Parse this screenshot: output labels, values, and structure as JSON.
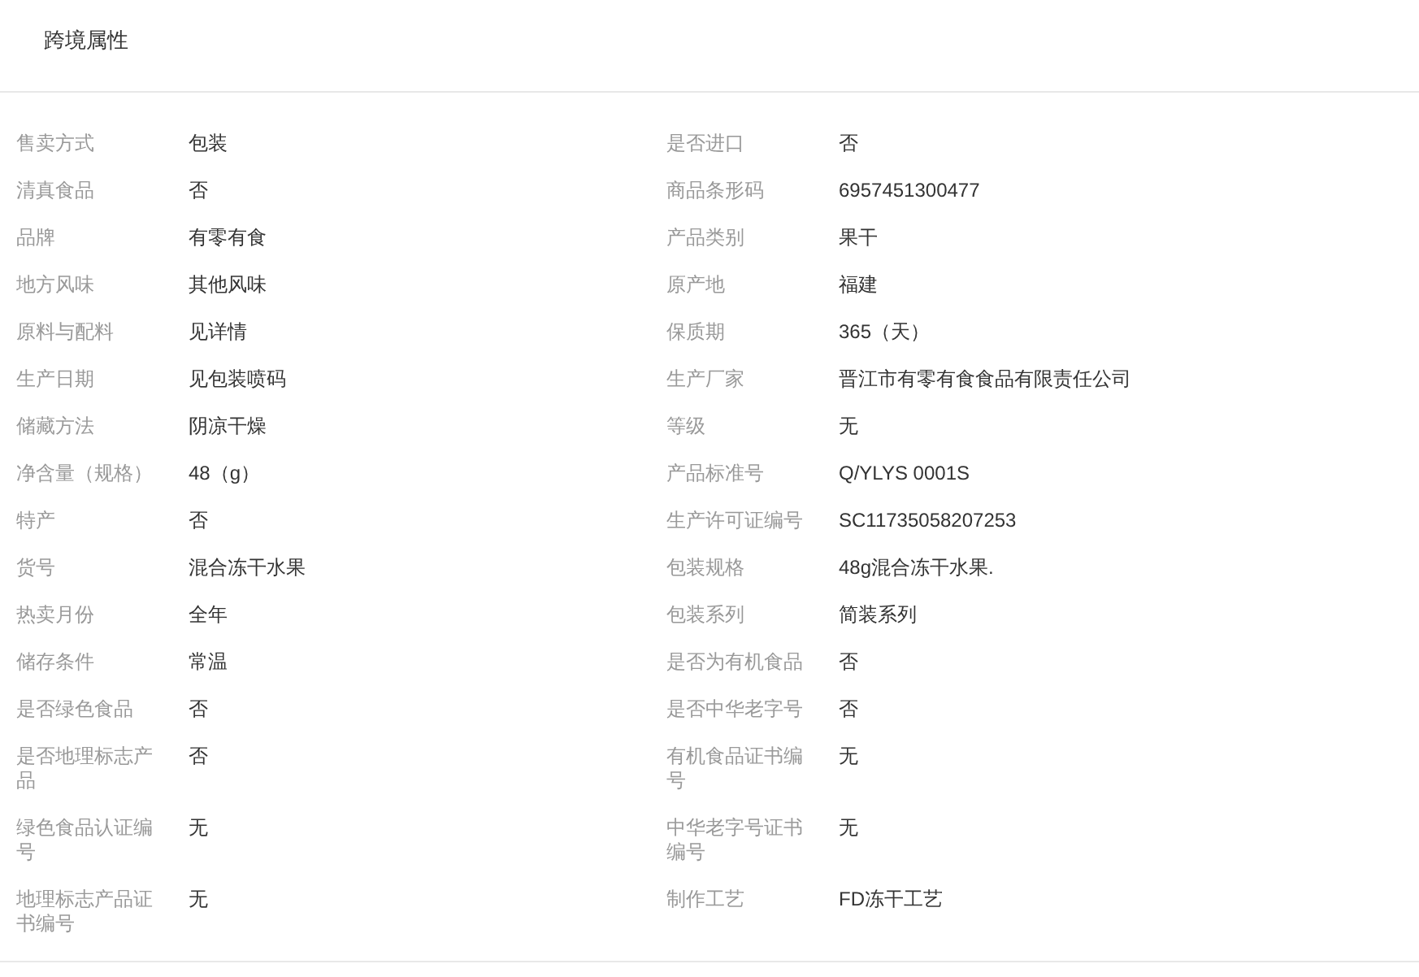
{
  "section": {
    "title": "跨境属性"
  },
  "attributes": [
    {
      "label": "售卖方式",
      "value": "包装"
    },
    {
      "label": "是否进口",
      "value": "否"
    },
    {
      "label": "清真食品",
      "value": "否"
    },
    {
      "label": "商品条形码",
      "value": "6957451300477"
    },
    {
      "label": "品牌",
      "value": "有零有食"
    },
    {
      "label": "产品类别",
      "value": "果干"
    },
    {
      "label": "地方风味",
      "value": "其他风味"
    },
    {
      "label": "原产地",
      "value": "福建"
    },
    {
      "label": "原料与配料",
      "value": "见详情"
    },
    {
      "label": "保质期",
      "value": "365（天）"
    },
    {
      "label": "生产日期",
      "value": "见包装喷码"
    },
    {
      "label": "生产厂家",
      "value": "晋江市有零有食食品有限责任公司"
    },
    {
      "label": "储藏方法",
      "value": "阴凉干燥"
    },
    {
      "label": "等级",
      "value": "无"
    },
    {
      "label": "净含量（规格）",
      "value": "48（g）"
    },
    {
      "label": "产品标准号",
      "value": "Q/YLYS 0001S"
    },
    {
      "label": "特产",
      "value": "否"
    },
    {
      "label": "生产许可证编号",
      "value": "SC11735058207253"
    },
    {
      "label": "货号",
      "value": "混合冻干水果"
    },
    {
      "label": "包装规格",
      "value": "48g混合冻干水果."
    },
    {
      "label": "热卖月份",
      "value": "全年"
    },
    {
      "label": "包装系列",
      "value": "简装系列"
    },
    {
      "label": "储存条件",
      "value": "常温"
    },
    {
      "label": "是否为有机食品",
      "value": "否"
    },
    {
      "label": "是否绿色食品",
      "value": "否"
    },
    {
      "label": "是否中华老字号",
      "value": "否"
    },
    {
      "label": "是否地理标志产品",
      "value": "否"
    },
    {
      "label": "有机食品证书编号",
      "value": "无"
    },
    {
      "label": "绿色食品认证编号",
      "value": "无"
    },
    {
      "label": "中华老字号证书编号",
      "value": "无"
    },
    {
      "label": "地理标志产品证书编号",
      "value": "无"
    },
    {
      "label": "制作工艺",
      "value": "FD冻干工艺"
    }
  ]
}
